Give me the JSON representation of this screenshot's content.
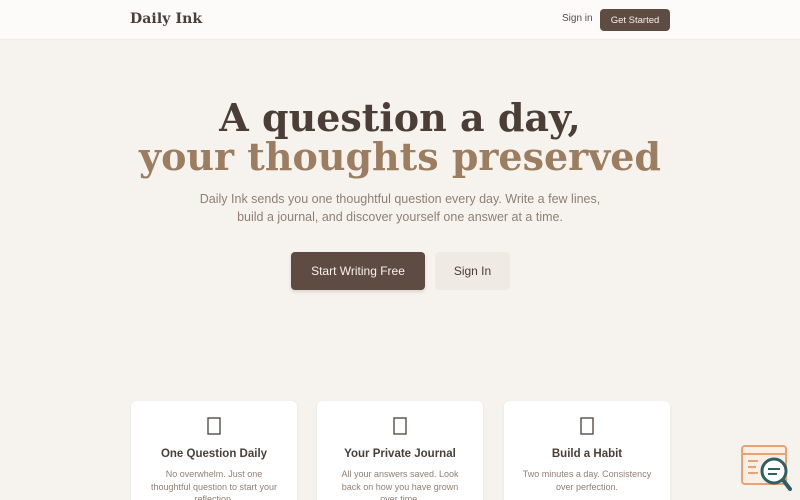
{
  "nav": {
    "brand": "Daily Ink",
    "signin_label": "Sign in",
    "cta_label": "Get Started"
  },
  "hero": {
    "headline_line1": "A question a day,",
    "headline_line2": "your thoughts preserved",
    "subtitle": "Daily Ink sends you one thoughtful question every day. Write a few lines, build a journal, and discover yourself one answer at a time.",
    "primary_button": "Start Writing Free",
    "secondary_button": "Sign In"
  },
  "features": [
    {
      "icon": "unknown-glyph-icon",
      "title": "One Question Daily",
      "description": "No overwhelm. Just one thoughtful question to start your reflection."
    },
    {
      "icon": "unknown-glyph-icon",
      "title": "Your Private Journal",
      "description": "All your answers saved. Look back on how you have grown over time."
    },
    {
      "icon": "unknown-glyph-icon",
      "title": "Build a Habit",
      "description": "Two minutes a day. Consistency over perfection."
    }
  ],
  "colors": {
    "background": "#f6f3ef",
    "primary": "#5e4b42",
    "accent_text": "#9c7d5f",
    "fab_orange": "#e8a274",
    "fab_teal": "#2f5f63"
  },
  "floating_widget": {
    "icon": "search-chat-icon"
  }
}
